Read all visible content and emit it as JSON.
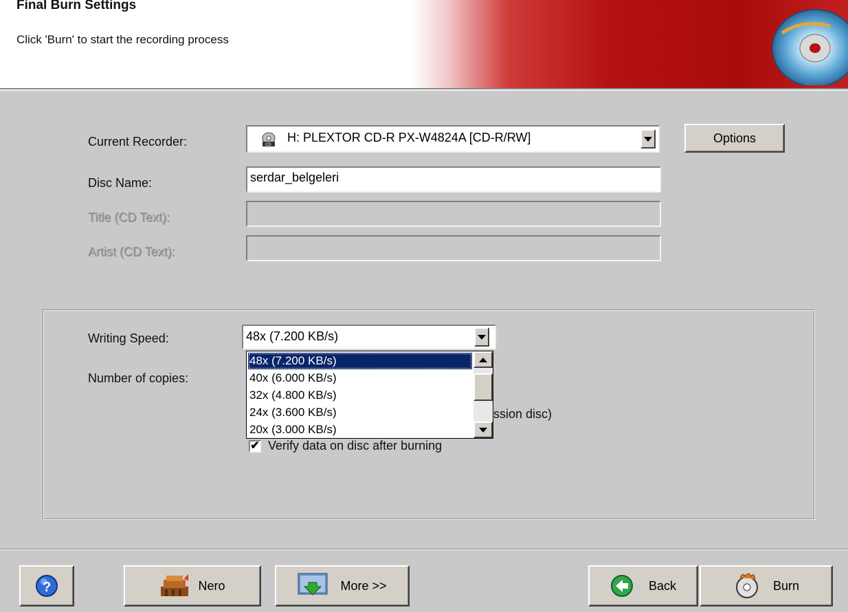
{
  "header": {
    "title": "Final Burn Settings",
    "subtitle": "Click 'Burn' to start the recording process"
  },
  "form": {
    "recorder_label": "Current Recorder:",
    "recorder_value": "H: PLEXTOR  CD-R   PX-W4824A  [CD-R/RW]",
    "options_label": "Options",
    "disc_name_label": "Disc Name:",
    "disc_name_value": "serdar_belgeleri",
    "title_label": "Title (CD Text):",
    "artist_label": "Artist (CD Text):"
  },
  "speed": {
    "label": "Writing Speed:",
    "selected": "48x (7.200 KB/s)",
    "options": [
      "48x (7.200 KB/s)",
      "40x (6.000 KB/s)",
      "32x (4.800 KB/s)",
      "24x (3.600 KB/s)",
      "20x (3.000 KB/s)"
    ]
  },
  "copies": {
    "label": "Number of copies:"
  },
  "multisession_partial": "ssion disc)",
  "verify": {
    "label": "Verify data on disc after burning",
    "checked": true
  },
  "footer": {
    "nero_label": "Nero",
    "more_label": "More >>",
    "back_label": "Back",
    "burn_label": "Burn"
  },
  "icons": {
    "help": "help-icon",
    "nero": "nero-icon",
    "more": "more-icon",
    "back": "back-arrow-icon",
    "burn": "burn-disc-icon",
    "recorder": "cd-drive-icon"
  }
}
